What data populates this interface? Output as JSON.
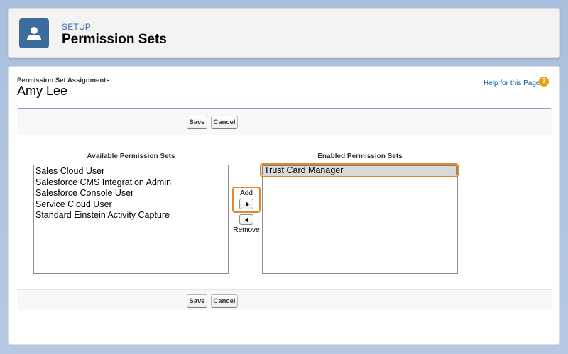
{
  "header": {
    "eyebrow": "SETUP",
    "title": "Permission Sets"
  },
  "page": {
    "section_label": "Permission Set Assignments",
    "user_name": "Amy Lee",
    "help_link": "Help for this Page"
  },
  "buttons": {
    "save": "Save",
    "cancel": "Cancel",
    "add": "Add",
    "remove": "Remove"
  },
  "available": {
    "header": "Available Permission Sets",
    "items": [
      "Sales Cloud User",
      "Salesforce CMS Integration Admin",
      "Salesforce Console User",
      "Service Cloud User",
      "Standard Einstein Activity Capture"
    ]
  },
  "enabled": {
    "header": "Enabled Permission Sets",
    "items": [
      "Trust Card Manager"
    ]
  },
  "colors": {
    "highlight": "#e0892c",
    "header_icon": "#3c6c9c",
    "link": "#015ba7"
  }
}
